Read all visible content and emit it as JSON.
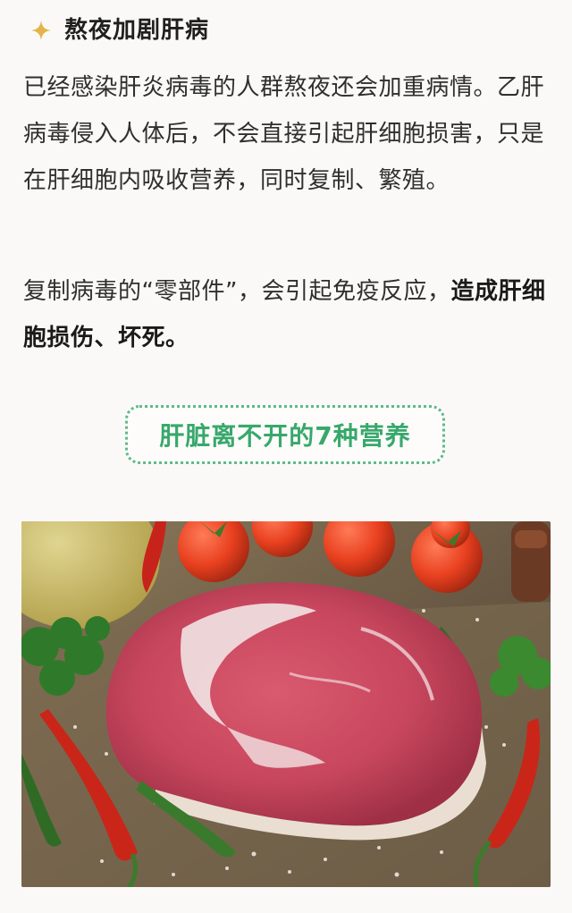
{
  "header": {
    "icon": "sparkle-star-icon",
    "icon_color": "#e3b44a",
    "title": "熬夜加剧肝病"
  },
  "paragraph1": {
    "text": "已经感染肝炎病毒的人群熬夜还会加重病情。乙肝病毒侵入人体后，不会直接引起肝细胞损害，只是在肝细胞内吸收营养，同时复制、繁殖。"
  },
  "paragraph2": {
    "text_plain": "复制病毒的“零部件”，会引起免疫反应，",
    "text_bold": "造成肝细胞损伤、坏死。"
  },
  "section_banner": {
    "label": "肝脏离不开的7种营养",
    "accent_color": "#38a86c"
  },
  "image": {
    "subject": "raw-steak-with-tomatoes-and-peppers"
  }
}
